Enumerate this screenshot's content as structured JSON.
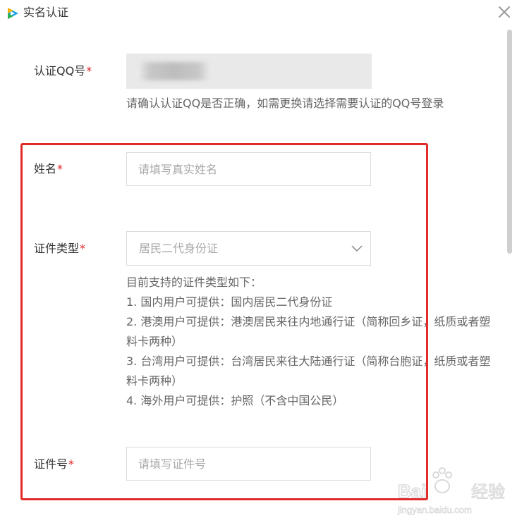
{
  "window": {
    "title": "实名认证"
  },
  "qq_field": {
    "label": "认证QQ号",
    "required_mark": "*",
    "hint": "请确认认证QQ是否正确，如需更换请选择需要认证的QQ号登录"
  },
  "name_field": {
    "label": "姓名",
    "required_mark": "*",
    "placeholder": "请填写真实姓名",
    "value": ""
  },
  "id_type_field": {
    "label": "证件类型",
    "required_mark": "*",
    "selected": "居民二代身份证",
    "support_title": "目前支持的证件类型如下：",
    "support_items": [
      "1. 国内用户可提供：国内居民二代身份证",
      "2. 港澳用户可提供：港澳居民来往内地通行证（简称回乡证，纸质或者塑料卡两种）",
      "3. 台湾用户可提供：台湾居民来往大陆通行证（简称台胞证，纸质或者塑料卡两种）",
      "4. 海外用户可提供：护照（不含中国公民）"
    ]
  },
  "id_number_field": {
    "label": "证件号",
    "required_mark": "*",
    "placeholder": "请填写证件号",
    "value": ""
  },
  "watermark": {
    "brand_text": "Bai",
    "brand_suffix": "经验",
    "url_text": "jingyan.baidu.com"
  },
  "colors": {
    "required": "#e02424",
    "highlight_border": "#e12a2a",
    "app_icon_green": "#2bb24c",
    "app_icon_blue": "#1aa2e6",
    "app_icon_yellow": "#f7b500"
  }
}
